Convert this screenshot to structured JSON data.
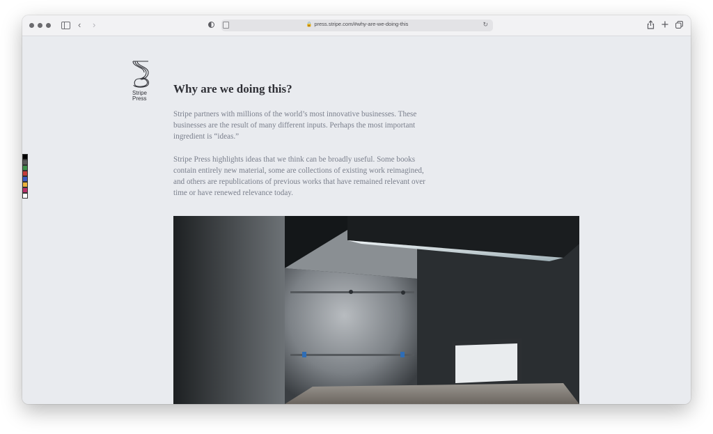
{
  "browser": {
    "url": "press.stripe.com/#why-are-we-doing-this"
  },
  "logo": {
    "line1": "Stripe",
    "line2": "Press"
  },
  "section": {
    "heading": "Why are we doing this?",
    "paragraph1": "Stripe partners with millions of the world’s most innovative businesses. These businesses are the result of many different inputs. Perhaps the most important ingredient is “ideas.”",
    "paragraph2": "Stripe Press highlights ideas that we think can be broadly useful. Some books contain entirely new material, some are collections of existing work reimagined, and others are republications of previous works that have remained relevant over time or have renewed relevance today."
  },
  "swatch_colors": [
    "#000000",
    "#5a5a5a",
    "#3f8f4a",
    "#c43d3a",
    "#3b5bc4",
    "#e8b23c",
    "#b8306a",
    "#ffffff"
  ],
  "icons": [
    "window-controls",
    "sidebar-icon",
    "back-arrow-icon",
    "forward-arrow-icon",
    "privacy-shield-icon",
    "reader-icon",
    "lock-icon",
    "reload-icon",
    "share-icon",
    "new-tab-icon",
    "tab-overview-icon"
  ]
}
